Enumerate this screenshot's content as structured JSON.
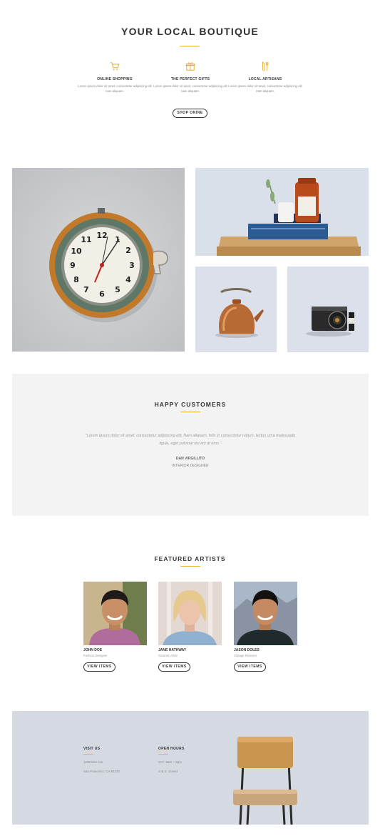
{
  "hero": {
    "title": "YOUR LOCAL BOUTIQUE",
    "accent_color": "#e8b33a",
    "features": [
      {
        "icon": "cart-icon",
        "title": "ONLINE SHOPPING",
        "text": "Lorem ipsum dolor sit amet, consectetur adipiscing elit nam aliquam."
      },
      {
        "icon": "gift-icon",
        "title": "THE PERFECT GIFTS",
        "text": "Lorem ipsum dolor sit amet, consectetur adipiscing elit nam aliquam."
      },
      {
        "icon": "tools-icon",
        "title": "LOCAL ARTISANS",
        "text": "Lorem ipsum dolor sit amet, consectetur adipiscing elit nam aliquam."
      }
    ],
    "cta_label": "SHOP ONINE"
  },
  "gallery": {
    "images": [
      "wall-clock-photo",
      "jar-on-books-photo",
      "copper-kettle-photo",
      "vintage-camera-photo"
    ]
  },
  "testimonial": {
    "title": "HAPPY CUSTOMERS",
    "quote": "\"Lorem ipsum dolor sit amet, consectetur adipiscing elit. Nam aliquam, felis in consectetur rutrum, lectus urna malesuada ligula, eget pulvinar dui leo at eros.\"",
    "name": "DAN VIRGILLITO",
    "role": "INTERIOR DESIGNER"
  },
  "artists": {
    "title": "FEATURED ARTISTS",
    "items": [
      {
        "name": "JOHN DOE",
        "role": "Fashion Designer",
        "button": "VIEW ITEMS"
      },
      {
        "name": "JANE HATHWAY",
        "role": "Ceramic Artist",
        "button": "VIEW ITEMS"
      },
      {
        "name": "JASON DOLES",
        "role": "Vintage Restorer",
        "button": "VIEW ITEMS"
      }
    ]
  },
  "footer": {
    "visit_title": "VISIT US",
    "address_line1": "1235 Divi Ave",
    "address_line2": "San Francisco, CA 93132",
    "hours_title": "OPEN HOURS",
    "hours_line1": "M-F: 8am – 8pm",
    "hours_line2": "S & S: closed"
  }
}
